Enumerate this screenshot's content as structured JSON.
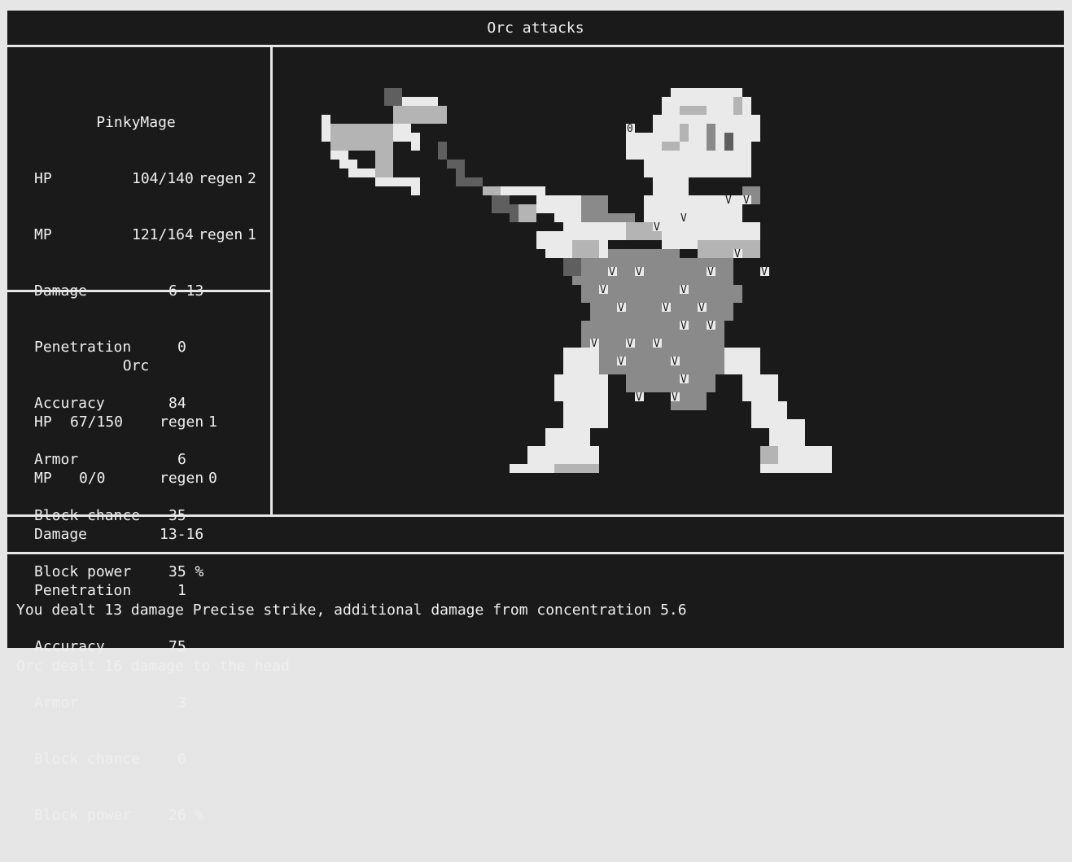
{
  "header": {
    "title": "Orc attacks"
  },
  "player": {
    "name": "PinkyMage",
    "rows": [
      {
        "label": "HP",
        "value": "104/140",
        "extra_label": "regen",
        "extra_value": "2"
      },
      {
        "label": "MP",
        "value": "121/164",
        "extra_label": "regen",
        "extra_value": "1"
      },
      {
        "label": "Damage",
        "value": "6-13"
      },
      {
        "label": "Penetration",
        "value": "0"
      },
      {
        "label": "Accuracy",
        "value": "84"
      },
      {
        "label": "Armor",
        "value": "6"
      },
      {
        "label": "Block chance",
        "value": "35"
      },
      {
        "label": "Block power",
        "value": "35 %"
      }
    ]
  },
  "enemy": {
    "name": "Orc",
    "rows": [
      {
        "label": "HP",
        "value": "67/150",
        "extra_label": "regen",
        "extra_value": "1"
      },
      {
        "label": "MP",
        "value": "0/0",
        "extra_label": "regen",
        "extra_value": "0"
      },
      {
        "label": "Damage",
        "value": "13-16"
      },
      {
        "label": "Penetration",
        "value": "1"
      },
      {
        "label": "Accuracy",
        "value": "75"
      },
      {
        "label": "Armor",
        "value": "3"
      },
      {
        "label": "Block chance",
        "value": "0"
      },
      {
        "label": "Block power",
        "value": "26 %"
      }
    ]
  },
  "action_bar": {
    "text": ""
  },
  "log": {
    "lines": [
      "You dealt 13 damage Precise strike, additional damage from concentration 5.6",
      "Orc dealt 16 damage to the head"
    ]
  },
  "sprite": {
    "name": "orc-sprite",
    "colors": {
      "light": "#eaeaea",
      "mid": "#b4b4b4",
      "dark": "#8a8a8a",
      "darker": "#5f5f5f"
    }
  }
}
